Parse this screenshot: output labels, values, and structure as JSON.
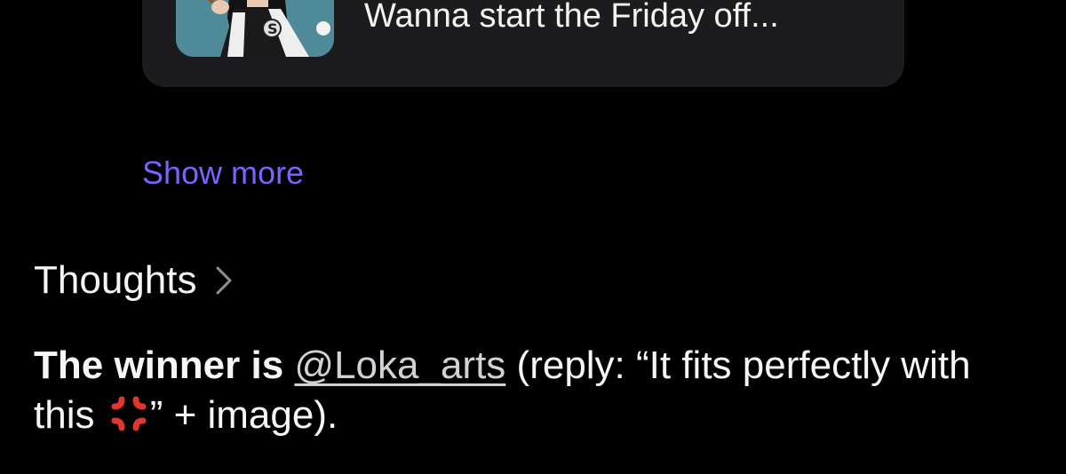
{
  "quoted_card": {
    "preview_text": "Wanna start the Friday off..."
  },
  "show_more_label": "Show more",
  "section": {
    "title": "Thoughts",
    "chevron_icon": "chevron-right-icon"
  },
  "post": {
    "bold_text": "The winner is",
    "mention": "@Loka_arts",
    "text_part_1": " (reply: “It fits perfectly with this ",
    "emoji": "anger-symbol-emoji",
    "text_part_2": "” + image)."
  },
  "colors": {
    "background": "#000000",
    "card": "#1c1c1e",
    "accent": "#7b61ff",
    "text": "#f5f5f5"
  }
}
